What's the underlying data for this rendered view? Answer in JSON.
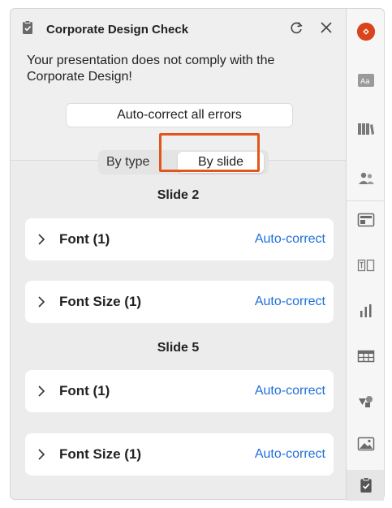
{
  "header": {
    "title": "Corporate Design Check",
    "icons": {
      "app": "clipboard-check-icon",
      "refresh": "refresh-icon",
      "close": "close-icon"
    }
  },
  "message": "Your presentation does not comply with the Corporate Design!",
  "autocorrect_all_label": "Auto-correct all errors",
  "view_toggle": {
    "options": [
      "By type",
      "By slide"
    ],
    "selected": "By slide"
  },
  "groups": [
    {
      "heading": "Slide 2",
      "issues": [
        {
          "label": "Font (1)",
          "action": "Auto-correct"
        },
        {
          "label": "Font Size (1)",
          "action": "Auto-correct"
        }
      ]
    },
    {
      "heading": "Slide 5",
      "issues": [
        {
          "label": "Font (1)",
          "action": "Auto-correct"
        },
        {
          "label": "Font Size (1)",
          "action": "Auto-correct"
        }
      ]
    }
  ],
  "sidebar": {
    "items": [
      "addin-logo-icon",
      "text-style-icon",
      "library-icon",
      "people-icon",
      "layout-icon",
      "textbox-icon",
      "chart-icon",
      "table-icon",
      "shapes-icon",
      "image-icon",
      "clipboard-check-icon"
    ],
    "active": "clipboard-check-icon"
  },
  "colors": {
    "accent_link": "#1d6fd8",
    "highlight": "#e0561c",
    "logo": "#d9441c",
    "panel_bg": "#efefef"
  }
}
